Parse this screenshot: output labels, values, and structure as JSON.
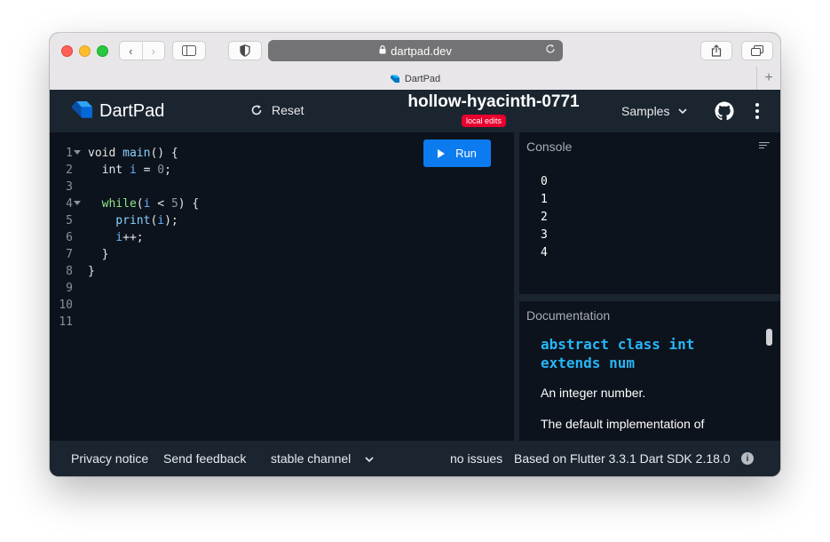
{
  "browser": {
    "url": "dartpad.dev",
    "tab_title": "DartPad",
    "back_glyph": "‹",
    "forward_glyph": "›",
    "new_tab_glyph": "+"
  },
  "header": {
    "app_name": "DartPad",
    "reset_label": "Reset",
    "pad_name": "hollow-hyacinth-0771",
    "badge": "local edits",
    "samples_label": "Samples"
  },
  "editor": {
    "run_label": "Run",
    "line_numbers": [
      "1",
      "2",
      "3",
      "4",
      "5",
      "6",
      "7",
      "8",
      "9",
      "10",
      "11"
    ],
    "code": [
      [
        {
          "t": "void ",
          "c": "kw"
        },
        {
          "t": "main",
          "c": "fn"
        },
        {
          "t": "() {",
          "c": "kw"
        }
      ],
      [
        {
          "t": "  int ",
          "c": "kw"
        },
        {
          "t": "i",
          "c": "v"
        },
        {
          "t": " = ",
          "c": "kw"
        },
        {
          "t": "0",
          "c": "n"
        },
        {
          "t": ";",
          "c": "kw"
        }
      ],
      [],
      [
        {
          "t": "  while",
          "c": "ctl"
        },
        {
          "t": "(",
          "c": "kw"
        },
        {
          "t": "i",
          "c": "v"
        },
        {
          "t": " < ",
          "c": "kw"
        },
        {
          "t": "5",
          "c": "n"
        },
        {
          "t": ") {",
          "c": "kw"
        }
      ],
      [
        {
          "t": "    print",
          "c": "fn"
        },
        {
          "t": "(",
          "c": "kw"
        },
        {
          "t": "i",
          "c": "v"
        },
        {
          "t": ");",
          "c": "kw"
        }
      ],
      [
        {
          "t": "    i",
          "c": "v"
        },
        {
          "t": "++;",
          "c": "kw"
        }
      ],
      [
        {
          "t": "  }",
          "c": "kw"
        }
      ],
      [
        {
          "t": "}",
          "c": "kw"
        }
      ],
      [],
      [],
      []
    ],
    "folded_lines": [
      1,
      4
    ]
  },
  "console": {
    "title": "Console",
    "output": [
      "0",
      "1",
      "2",
      "3",
      "4"
    ]
  },
  "documentation": {
    "title": "Documentation",
    "heading_line1": "abstract class int",
    "heading_line2": "extends num",
    "para1": "An integer number.",
    "para2": "The default implementation of"
  },
  "footer": {
    "privacy": "Privacy notice",
    "feedback": "Send feedback",
    "channel": "stable channel",
    "issues": "no issues",
    "version": "Based on Flutter 3.3.1 Dart SDK 2.18.0"
  },
  "colors": {
    "run_button": "#0d7bf0",
    "badge": "#e8002e",
    "doc_heading": "#27b6f6"
  }
}
